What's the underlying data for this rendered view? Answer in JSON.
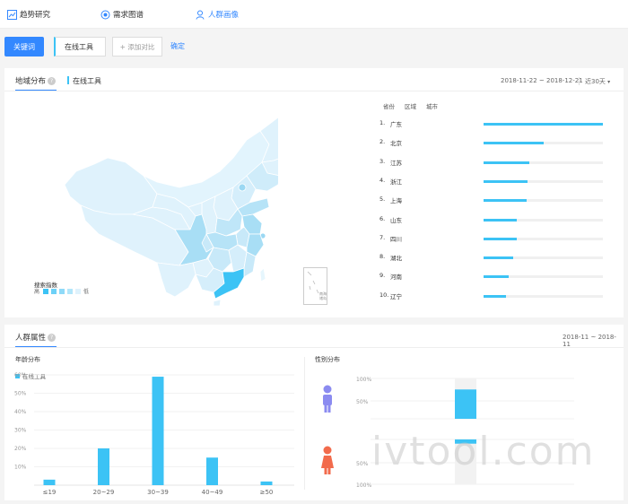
{
  "nav": {
    "trend": "趋势研究",
    "demand": "需求图谱",
    "portrait": "人群画像"
  },
  "search": {
    "keyword_button": "关键词",
    "keyword_value": "在线工具",
    "add_compare": "+ 添加对比",
    "confirm": "确定"
  },
  "region": {
    "tab": "地域分布",
    "series": "在线工具",
    "date_range": "2018-11-22 ~ 2018-12-21",
    "range_select": "近30天",
    "list_header": [
      "省份",
      "区域",
      "城市"
    ],
    "map_legend_title": "搜索指数",
    "map_legend_high": "高",
    "map_legend_low": "低",
    "inset_label": "南海诸岛",
    "rows": [
      {
        "rank": "1.",
        "name": "广东",
        "value": 100
      },
      {
        "rank": "2.",
        "name": "北京",
        "value": 50
      },
      {
        "rank": "3.",
        "name": "江苏",
        "value": 38
      },
      {
        "rank": "4.",
        "name": "浙江",
        "value": 37
      },
      {
        "rank": "5.",
        "name": "上海",
        "value": 36
      },
      {
        "rank": "6.",
        "name": "山东",
        "value": 28
      },
      {
        "rank": "7.",
        "name": "四川",
        "value": 28
      },
      {
        "rank": "8.",
        "name": "湖北",
        "value": 25
      },
      {
        "rank": "9.",
        "name": "河南",
        "value": 21
      },
      {
        "rank": "10.",
        "name": "辽宁",
        "value": 19
      }
    ]
  },
  "audience": {
    "tab": "人群属性",
    "date_range": "2018-11 ~ 2018-11",
    "age_title": "年龄分布",
    "gender_title": "性别分布",
    "age_legend": "在线工具",
    "age_ticks": [
      "60%",
      "50%",
      "40%",
      "30%",
      "20%",
      "10%"
    ],
    "gender_ticks_top": [
      "100%",
      "50%"
    ],
    "gender_ticks_bottom": [
      "50%",
      "100%"
    ]
  },
  "chart_data": {
    "type": "bar",
    "categories": [
      "≤19",
      "20~29",
      "30~39",
      "40~49",
      "≥50"
    ],
    "series": [
      {
        "name": "在线工具",
        "values": [
          3,
          20,
          59,
          15,
          2
        ]
      }
    ],
    "ylim": [
      0,
      60
    ]
  },
  "gender_data": {
    "male": 79,
    "female": 21
  },
  "watermark": "ivtool.com",
  "colors": {
    "accent": "#3388ff",
    "bar": "#3cc3f5",
    "male": "#8b8bf0",
    "female": "#f26b4c"
  }
}
